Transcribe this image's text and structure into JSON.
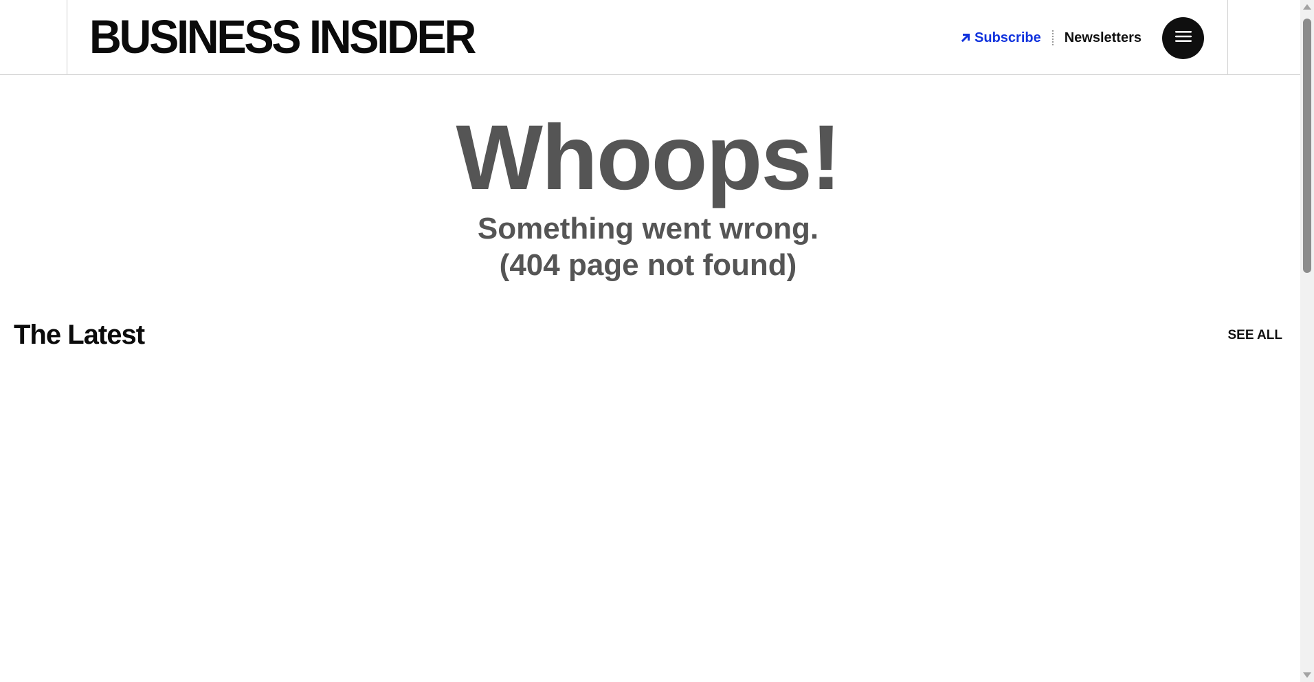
{
  "header": {
    "logo_text": "BUSINESS INSIDER",
    "subscribe_label": "Subscribe",
    "newsletters_label": "Newsletters",
    "menu_icon": "hamburger-menu-icon",
    "subscribe_icon": "arrow-up-right-icon",
    "accent_color": "#1133dd"
  },
  "error": {
    "title": "Whoops!",
    "line1": "Something went wrong.",
    "line2": "(404 page not found)"
  },
  "latest": {
    "title": "The Latest",
    "see_all_label": "SEE ALL"
  }
}
